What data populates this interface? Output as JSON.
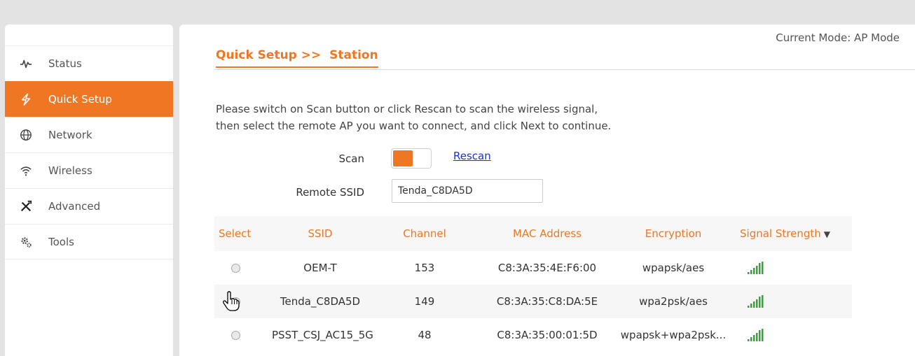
{
  "nav": {
    "items": [
      {
        "label": "Status",
        "icon": "pulse-icon"
      },
      {
        "label": "Quick Setup",
        "icon": "bolt-icon"
      },
      {
        "label": "Network",
        "icon": "globe-icon"
      },
      {
        "label": "Wireless",
        "icon": "wifi-icon"
      },
      {
        "label": "Advanced",
        "icon": "tools-cross-icon"
      },
      {
        "label": "Tools",
        "icon": "gears-icon"
      }
    ],
    "active": "Quick Setup"
  },
  "header": {
    "mode": "Current Mode: AP Mode",
    "title": "Quick Setup >>  Station"
  },
  "instructions": {
    "line1": "Please switch on Scan button or click Rescan to scan the wireless signal,",
    "line2": "then select the remote AP you want to connect, and click Next to continue."
  },
  "scan": {
    "label": "Scan",
    "state": "on",
    "rescan_label": "Rescan"
  },
  "remote_ssid": {
    "label": "Remote SSID",
    "value": "Tenda_C8DA5D"
  },
  "table": {
    "headers": {
      "select": "Select",
      "ssid": "SSID",
      "channel": "Channel",
      "mac": "MAC Address",
      "encryption": "Encryption",
      "signal": "Signal Strength",
      "sort_indicator": "▼"
    },
    "rows": [
      {
        "ssid": "OEM-T",
        "channel": "153",
        "mac": "C8:3A:35:4E:F6:00",
        "encryption": "wpapsk/aes"
      },
      {
        "ssid": "Tenda_C8DA5D",
        "channel": "149",
        "mac": "C8:3A:35:C8:DA:5E",
        "encryption": "wpa2psk/aes"
      },
      {
        "ssid": "PSST_CSJ_AC15_5G",
        "channel": "48",
        "mac": "C8:3A:35:00:01:5D",
        "encryption": "wpapsk+wpa2psk..."
      }
    ]
  },
  "colors": {
    "accent": "#ef7623",
    "link": "#1a33cc",
    "signal": "#2fa82f"
  }
}
